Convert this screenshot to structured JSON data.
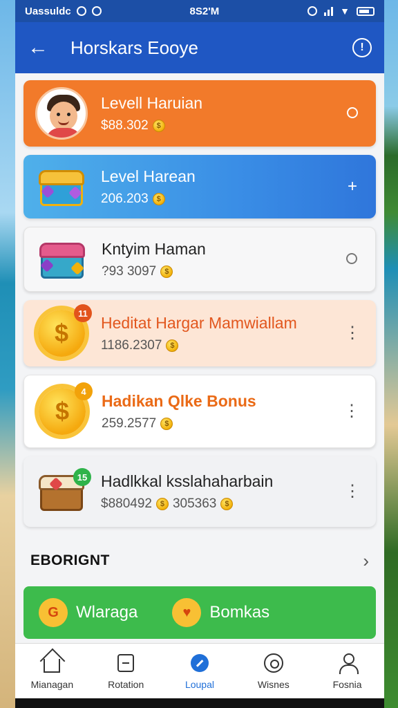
{
  "status_bar": {
    "carrier": "Uassuldc",
    "time": "8S2'M"
  },
  "app_bar": {
    "title": "Horskars Eooye",
    "back_icon": "arrow-left-icon",
    "info_icon": "info-icon"
  },
  "cards": [
    {
      "name": "Levell Haruian",
      "value": "$88.302",
      "action": "ring"
    },
    {
      "name": "Level Harean",
      "value": "206.203",
      "action": "+"
    },
    {
      "name": "Kntyim Haman",
      "value": "?93 3097",
      "action": "ring"
    },
    {
      "name": "Heditat Hargar Mamwiallam",
      "value": "1186.2307",
      "action": "⋮",
      "badge": "11"
    },
    {
      "name": "Hadikan Qlke Bonus",
      "value": "259.2577",
      "action": "⋮",
      "badge": "4"
    },
    {
      "name": "Hadlkkal ksslahaharbain",
      "value": "$880492",
      "value2": "305363",
      "action": "⋮",
      "badge": "15"
    }
  ],
  "section": {
    "title": "EBORIGNT"
  },
  "actions": [
    {
      "label": "Wlaraga"
    },
    {
      "label": "Bomkas"
    }
  ],
  "bottom_nav": [
    {
      "label": "Mianagan",
      "icon": "home-icon"
    },
    {
      "label": "Rotation",
      "icon": "calendar-icon"
    },
    {
      "label": "Loupal",
      "icon": "edit-icon",
      "active": true
    },
    {
      "label": "Wisnes",
      "icon": "chat-icon"
    },
    {
      "label": "Fosnia",
      "icon": "user-icon"
    }
  ],
  "colors": {
    "appbar": "#1f57c3",
    "orange_card": "#f27a2a",
    "blue_card": "#3a8ee6",
    "green_bar": "#3dbb4c",
    "active_nav": "#1f6fd8"
  }
}
